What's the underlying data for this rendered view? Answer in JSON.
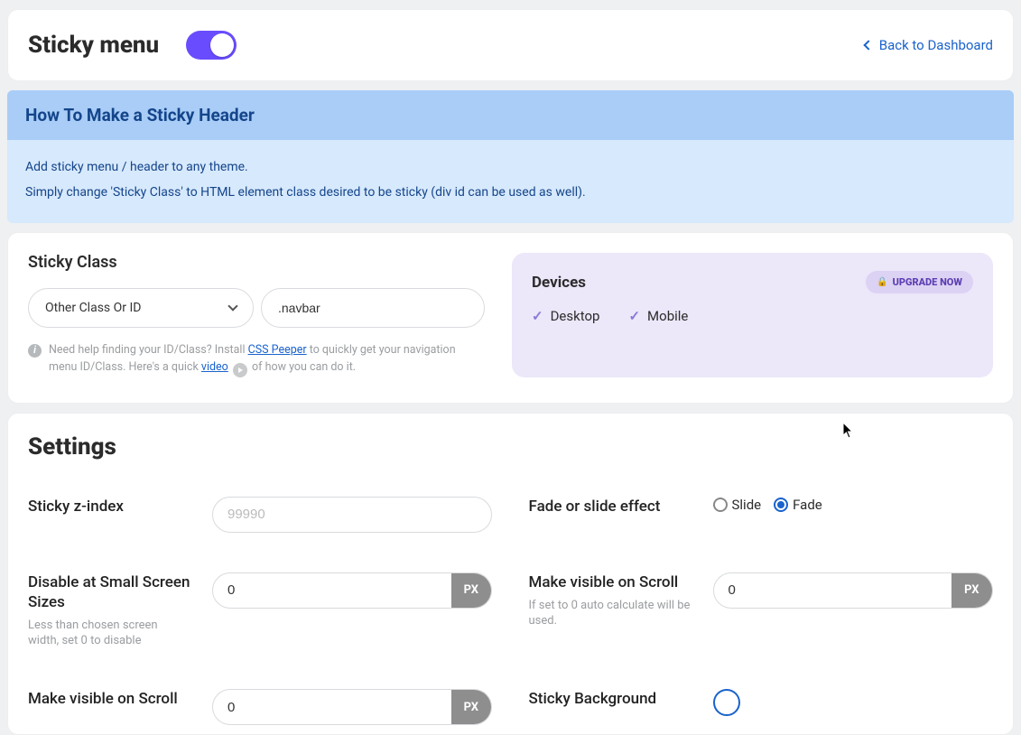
{
  "header": {
    "title": "Sticky menu",
    "toggle_on": true,
    "back_label": "Back to Dashboard"
  },
  "info": {
    "title": "How To Make a Sticky Header",
    "line1": "Add sticky menu / header to any theme.",
    "line2": "Simply change 'Sticky Class' to HTML element class desired to be sticky (div id can be used as well)."
  },
  "sticky_class": {
    "label": "Sticky Class",
    "select_value": "Other Class Or ID",
    "text_value": ".navbar",
    "help_pre": "Need help finding your ID/Class? Install ",
    "help_link1": "CSS Peeper",
    "help_mid": " to quickly get your navigation menu ID/Class. Here's a quick ",
    "help_link2": "video",
    "help_post": " of how you can do it."
  },
  "devices": {
    "title": "Devices",
    "upgrade": "UPGRADE NOW",
    "desktop": "Desktop",
    "mobile": "Mobile"
  },
  "settings": {
    "title": "Settings",
    "zindex": {
      "label": "Sticky z-index",
      "placeholder": "99990"
    },
    "effect": {
      "label": "Fade or slide effect",
      "slide": "Slide",
      "fade": "Fade",
      "selected": "fade"
    },
    "disable_small": {
      "label": "Disable at Small Screen Sizes",
      "hint": "Less than chosen screen width, set 0 to disable",
      "value": "0",
      "unit": "PX"
    },
    "visible_scroll": {
      "label": "Make visible on Scroll",
      "hint": "If set to 0 auto calculate will be used.",
      "value": "0",
      "unit": "PX"
    },
    "visible_home": {
      "label": "Make visible on Scroll",
      "value": "0",
      "unit": "PX"
    },
    "bg_color": {
      "label": "Sticky Background",
      "value": "#ffffff"
    }
  }
}
